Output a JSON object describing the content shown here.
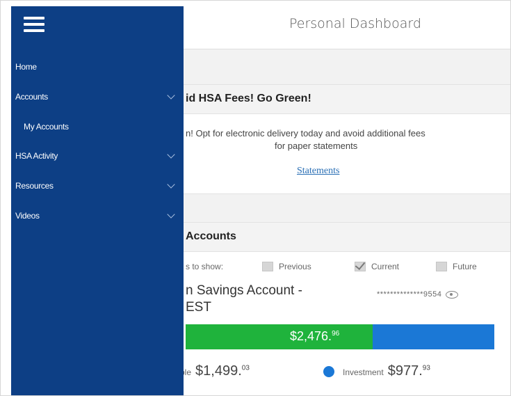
{
  "header": {
    "title": "Personal Dashboard"
  },
  "menu": {
    "icon": "hamburger-menu-icon"
  },
  "nav": {
    "items": [
      {
        "label": "Home",
        "expandable": false
      },
      {
        "label": "Accounts",
        "expandable": true
      },
      {
        "label": "My Accounts",
        "expandable": false,
        "sub": true
      },
      {
        "label": "HSA Activity",
        "expandable": true
      },
      {
        "label": "Resources",
        "expandable": true
      },
      {
        "label": "Videos",
        "expandable": true
      }
    ]
  },
  "promo": {
    "title": "id HSA Fees! Go Green!",
    "line1": "n! Opt for electronic delivery today and avoid additional fees",
    "line2": "for paper statements",
    "link": "Statements"
  },
  "accounts": {
    "title": "Accounts",
    "show_label": "s to show:",
    "filters": {
      "previous": "Previous",
      "current": "Current",
      "future": "Future",
      "current_checked": true
    },
    "account_name_line1": "n Savings Account -",
    "account_name_line2": "EST",
    "account_number": "**************9554",
    "total_main": "$2,476.",
    "total_cents": "96",
    "available_fraction": 0.6055,
    "available_label": "ilable",
    "available_main": "$1,499.",
    "available_cents": "03",
    "investment_label": "Investment",
    "investment_main": "$977.",
    "investment_cents": "93"
  },
  "colors": {
    "drawer": "#0d3f85",
    "available": "#1fb33c",
    "investment": "#1b78d6",
    "link": "#2a6fb5"
  }
}
